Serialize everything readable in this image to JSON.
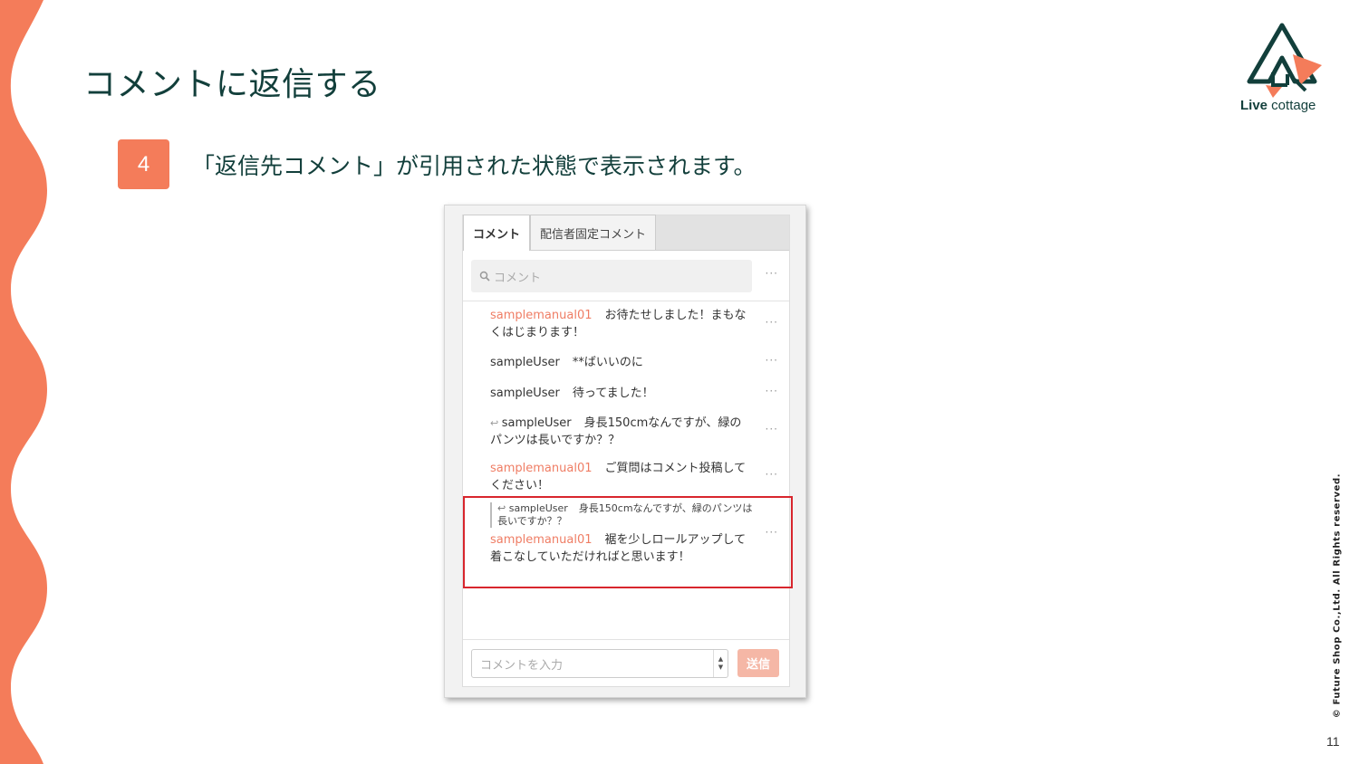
{
  "slide": {
    "title": "コメントに返信する",
    "step_number": "4",
    "step_text": "「返信先コメント」が引用された状態で表示されます。",
    "copyright": "© Future Shop Co.,Ltd. All Rights reserved.",
    "page_number": "11",
    "logo": {
      "bold": "Live",
      "rest": " cottage"
    }
  },
  "colors": {
    "accent": "#f47c5a",
    "title": "#123f3b",
    "highlight": "#d8262d",
    "username_orange": "#ef7d64"
  },
  "panel": {
    "tabs": [
      {
        "label": "コメント"
      },
      {
        "label": "配信者固定コメント"
      }
    ],
    "search": {
      "placeholder": "コメント",
      "menu": "···"
    },
    "comments": [
      {
        "user": "samplemanual01",
        "text": "お待たせしました！まもなくはじまります！",
        "menu": "···"
      },
      {
        "user": "sampleUser",
        "text": "**ばいいのに",
        "menu": "···"
      },
      {
        "user": "sampleUser",
        "text": "待ってました！",
        "menu": "···"
      },
      {
        "user": "sampleUser",
        "text": "身長150cmなんですが、緑のパンツは長いですか？？",
        "menu": "···"
      },
      {
        "user": "samplemanual01",
        "text": "ご質問はコメント投稿してください！",
        "menu": "···"
      }
    ],
    "reply": {
      "quoted_user": "sampleUser",
      "quoted_text": "身長150cmなんですが、緑のパンツは長いですか？？",
      "user": "samplemanual01",
      "text": "裾を少しロールアップして着こなしていただければと思います！",
      "menu": "···"
    },
    "input": {
      "placeholder": "コメントを入力",
      "send_label": "送信"
    }
  }
}
